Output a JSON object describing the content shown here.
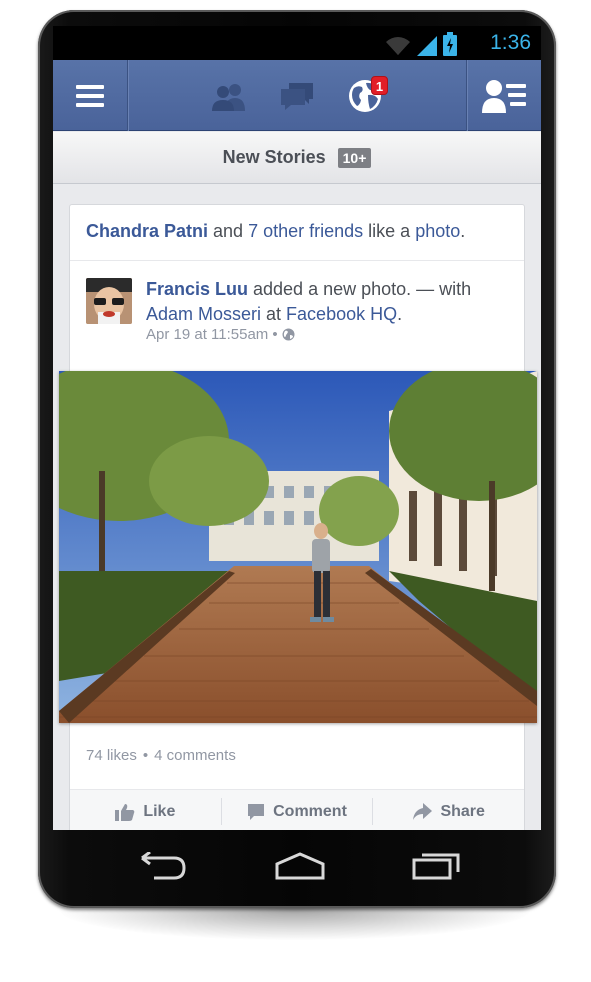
{
  "status_bar": {
    "time": "1:36",
    "icons": [
      "wifi-icon",
      "signal-icon",
      "battery-charging-icon"
    ],
    "accent": "#3bb4e9"
  },
  "nav_bar": {
    "icons": [
      "menu-icon",
      "friend-requests-icon",
      "messages-icon",
      "notifications-globe-icon",
      "friends-list-icon"
    ],
    "notification_count": "1",
    "color": "#4e67a0"
  },
  "new_stories": {
    "label": "New Stories",
    "count": "10+"
  },
  "story": {
    "header": {
      "actor": "Chandra Patni",
      "and": " and ",
      "others": "7 other friends",
      "action": " like a ",
      "object": "photo",
      "end": "."
    },
    "post": {
      "author": "Francis Luu",
      "action": " added a new photo. — with",
      "with_person": "Adam Mosseri",
      "at": " at ",
      "location": "Facebook HQ",
      "end": ".",
      "timestamp": "Apr 19 at 11:55am",
      "separator": "•",
      "privacy_icon": "globe-icon"
    },
    "likes": "74 likes",
    "dot": "•",
    "comments": "4 comments",
    "actions": [
      {
        "label": "Like",
        "icon": "thumbs-up-icon"
      },
      {
        "label": "Comment",
        "icon": "comment-bubble-icon"
      },
      {
        "label": "Share",
        "icon": "share-arrow-icon"
      }
    ]
  },
  "system_nav": [
    "back-icon",
    "home-icon",
    "recents-icon"
  ]
}
